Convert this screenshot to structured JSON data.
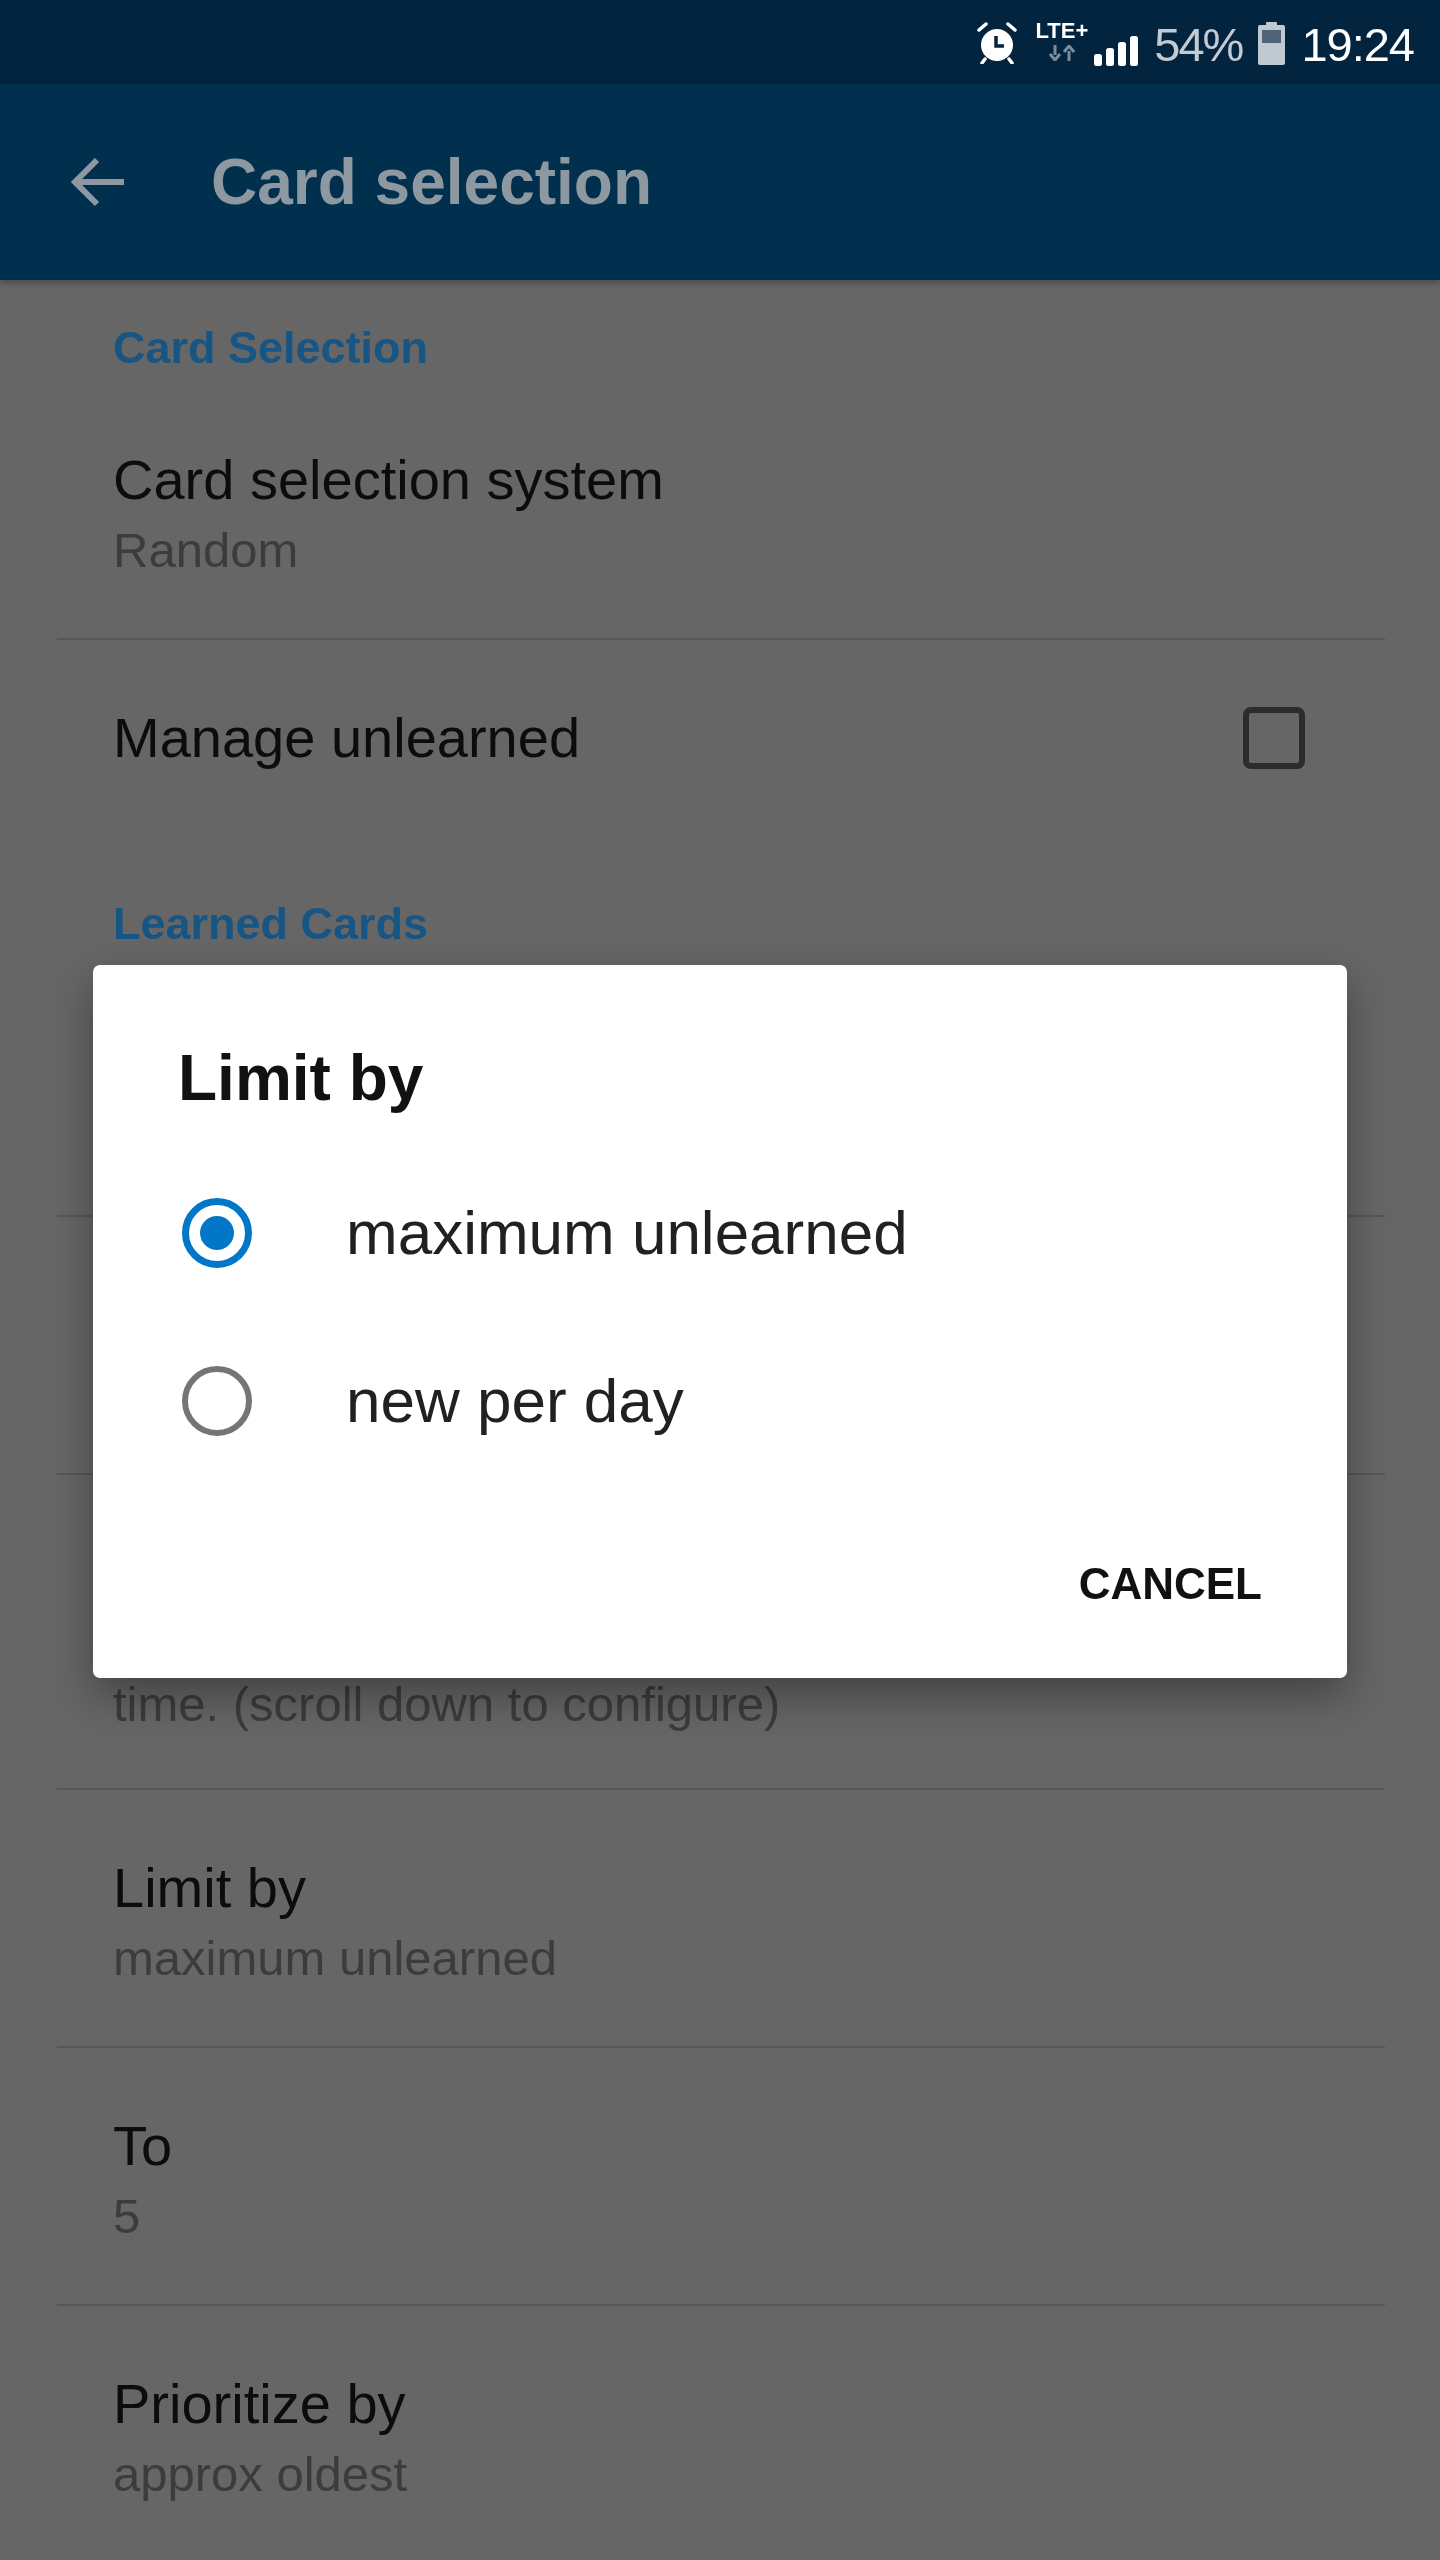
{
  "status_bar": {
    "network": "LTE+",
    "battery": "54%",
    "time": "19:24"
  },
  "app_bar": {
    "title": "Card selection"
  },
  "settings": [
    {
      "kind": "section",
      "title": "Card Selection"
    },
    {
      "kind": "value",
      "title": "Card selection system",
      "value": "Random"
    },
    {
      "kind": "checkbox",
      "title": "Manage unlearned",
      "checked": false
    },
    {
      "kind": "section",
      "title": "Learned Cards"
    },
    {
      "kind": "partial",
      "text": "time. (scroll down to configure)"
    },
    {
      "kind": "value",
      "title": "Limit by",
      "value": "maximum unlearned"
    },
    {
      "kind": "value",
      "title": "To",
      "value": "5"
    },
    {
      "kind": "value",
      "title": "Prioritize by",
      "value": "approx oldest"
    }
  ],
  "dialog": {
    "title": "Limit by",
    "options": [
      {
        "label": "maximum unlearned",
        "selected": true
      },
      {
        "label": "new per day",
        "selected": false
      }
    ],
    "buttons": [
      "CANCEL"
    ]
  }
}
